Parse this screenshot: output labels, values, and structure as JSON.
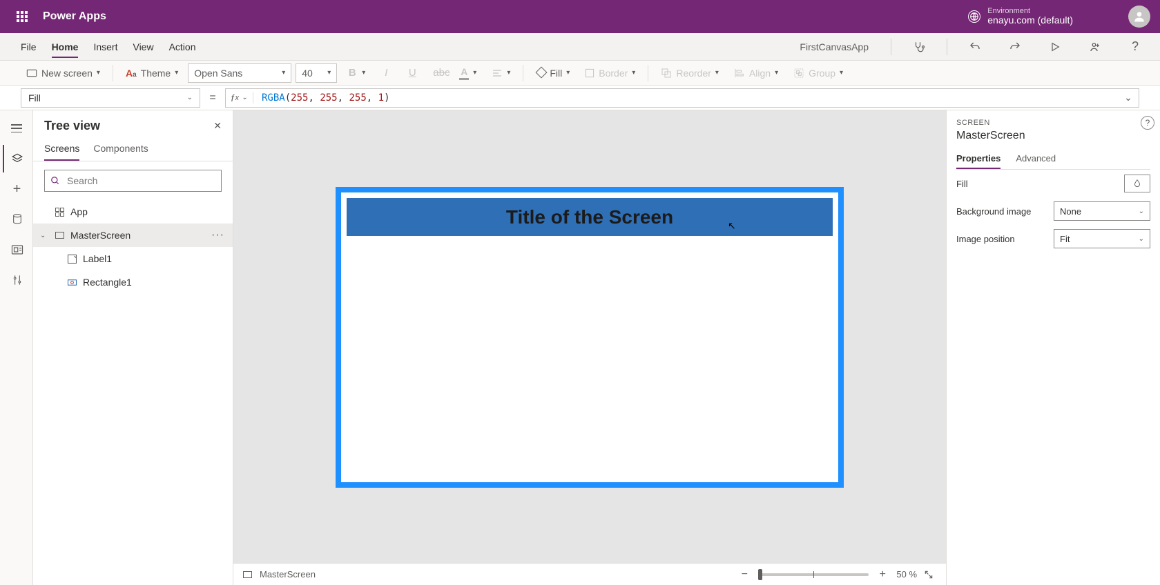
{
  "suite": {
    "title": "Power Apps",
    "env_label": "Environment",
    "env_name": "enayu.com (default)"
  },
  "menu": {
    "items": [
      "File",
      "Home",
      "Insert",
      "View",
      "Action"
    ],
    "active_index": 1,
    "app_name": "FirstCanvasApp"
  },
  "ribbon": {
    "new_screen": "New screen",
    "theme": "Theme",
    "font": "Open Sans",
    "size": "40",
    "fill": "Fill",
    "border": "Border",
    "reorder": "Reorder",
    "align": "Align",
    "group": "Group"
  },
  "formula": {
    "property": "Fill",
    "fn": "RGBA",
    "args": [
      "255",
      "255",
      "255",
      "1"
    ]
  },
  "tree": {
    "title": "Tree view",
    "tabs": [
      "Screens",
      "Components"
    ],
    "active_tab": 0,
    "search_placeholder": "Search",
    "items": {
      "app": "App",
      "master": "MasterScreen",
      "label": "Label1",
      "rect": "Rectangle1"
    }
  },
  "canvas": {
    "screen_title": "Title of the Screen",
    "zoom_percent": "50",
    "zoom_suffix": "%",
    "status_name": "MasterScreen"
  },
  "props": {
    "type_label": "SCREEN",
    "name": "MasterScreen",
    "tabs": [
      "Properties",
      "Advanced"
    ],
    "active_tab": 0,
    "fill_label": "Fill",
    "bg_img_label": "Background image",
    "bg_img_value": "None",
    "img_pos_label": "Image position",
    "img_pos_value": "Fit"
  }
}
